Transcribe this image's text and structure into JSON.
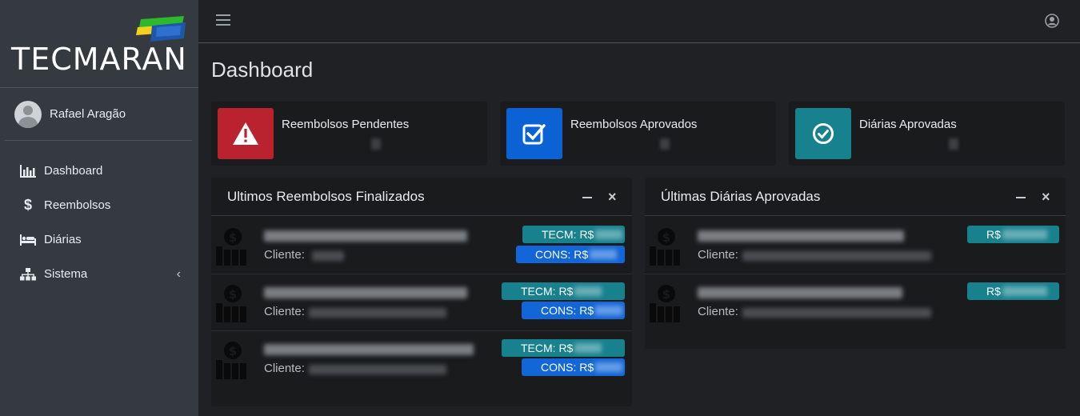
{
  "brand": {
    "name": "TECMARAN"
  },
  "user": {
    "name": "Rafael Aragão"
  },
  "nav": {
    "items": [
      {
        "label": "Dashboard",
        "icon": "bar-chart-icon"
      },
      {
        "label": "Reembolsos",
        "icon": "dollar-icon"
      },
      {
        "label": "Diárias",
        "icon": "bed-icon"
      },
      {
        "label": "Sistema",
        "icon": "sitemap-icon"
      }
    ]
  },
  "page": {
    "title": "Dashboard"
  },
  "info_boxes": [
    {
      "label": "Reembolsos Pendentes",
      "icon": "warning-icon",
      "color": "#b9222e"
    },
    {
      "label": "Reembolsos Aprovados",
      "icon": "check-square-icon",
      "color": "#0a62d4"
    },
    {
      "label": "Diárias Aprovadas",
      "icon": "check-circle-icon",
      "color": "#17818e"
    }
  ],
  "cards": {
    "reembolsos": {
      "title": "Ultimos Reembolsos Finalizados",
      "client_label": "Cliente:",
      "tecm_label": "TECM: R$",
      "cons_label": "CONS: R$"
    },
    "diarias": {
      "title": "Últimas Diárias Aprovadas",
      "client_label": "Cliente:",
      "value_label": "R$"
    }
  },
  "colors": {
    "sidebar": "#343a40",
    "background": "#1f2124",
    "card": "#1a1b1d",
    "tecm_badge": "#17818e",
    "cons_badge": "#1266d8"
  }
}
